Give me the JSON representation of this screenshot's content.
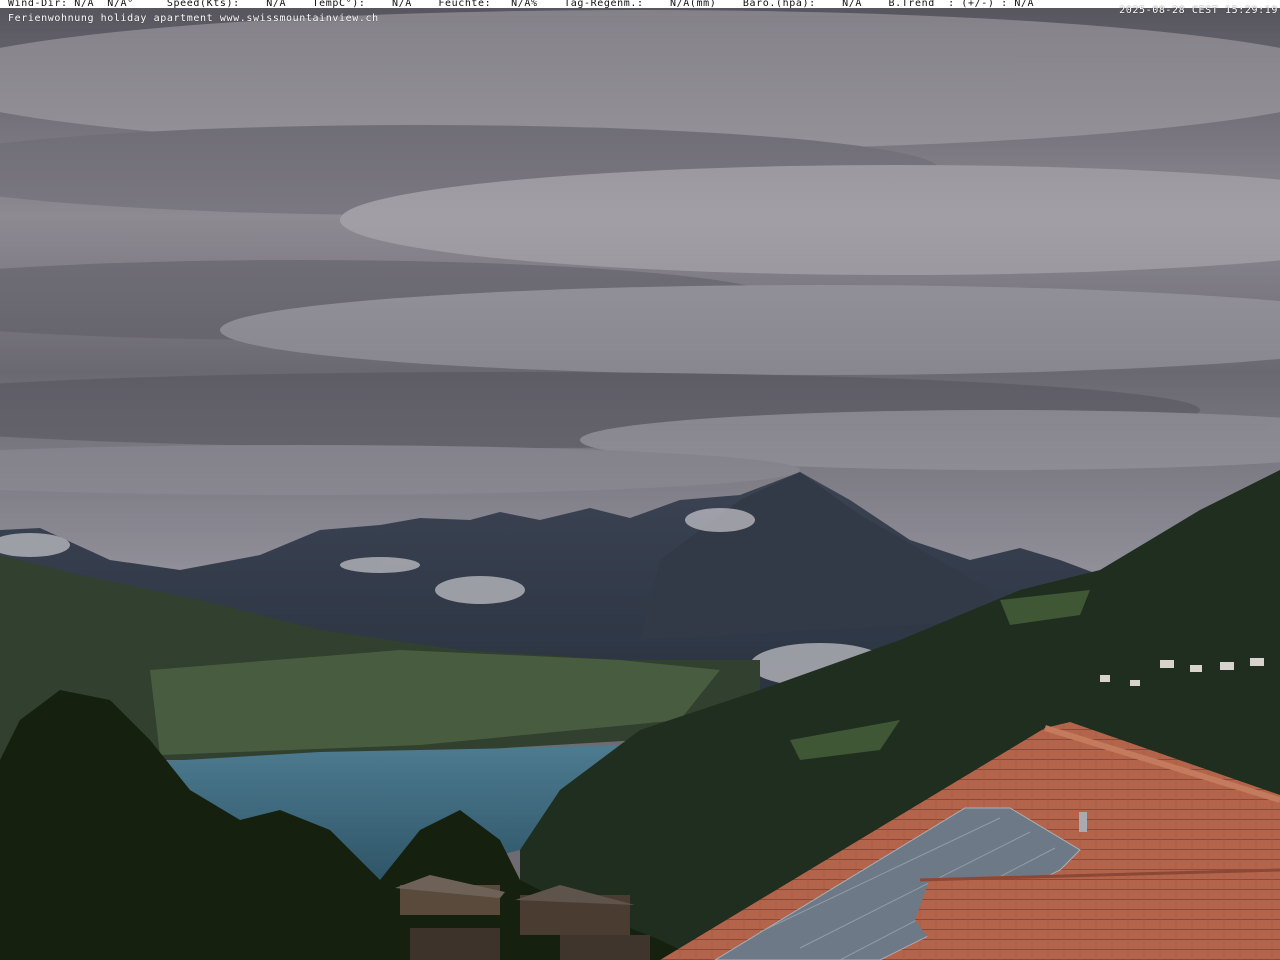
{
  "overlay": {
    "sensor_line": "Wind-Dir: N/A  N/A°     Speed(Kts):    N/A    TempC°):    N/A    Feuchte:   N/A%    Tag-Regenm.:    N/A(mm)    Baro.(hpa):    N/A    B.Trend  : (+/-) : N/A",
    "caption": "Ferienwohnung holiday apartment www.swissmountainview.ch",
    "timestamp": "2025-08-28 CEST 15:29:19"
  },
  "colors": {
    "sky_top": "#4a4a55",
    "sky_mid": "#8a8790",
    "lake": "#3f6a80",
    "forest": "#1e2d1e",
    "roof_tile": "#b8654a",
    "solar_panel": "#6f7c8a"
  }
}
